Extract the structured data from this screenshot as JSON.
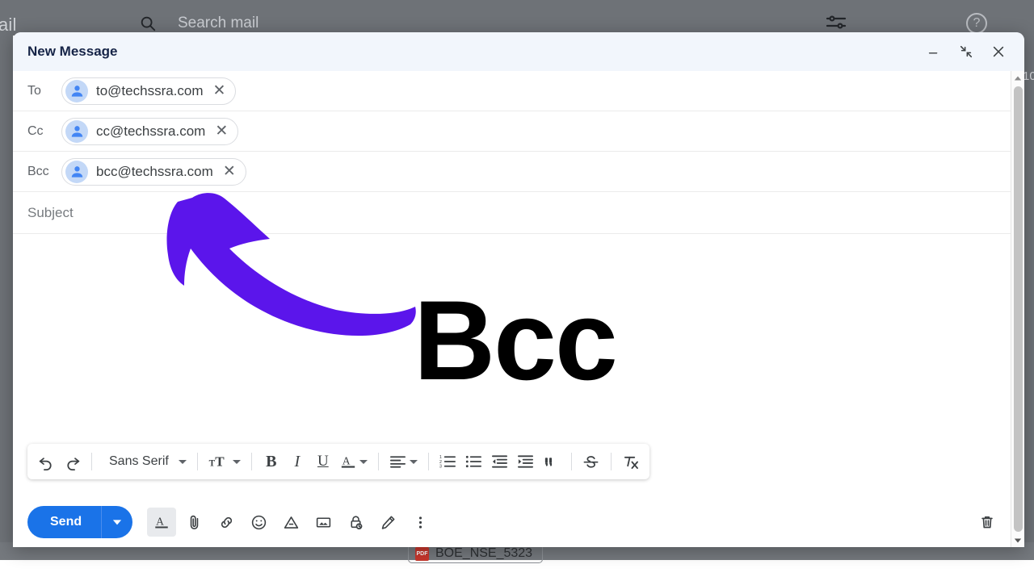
{
  "background": {
    "app_name": "ail",
    "search_placeholder": "Search mail",
    "unread_count": "10",
    "attachment": {
      "type_badge": "PDF",
      "name": "BOE_NSE_5323"
    },
    "icons": {
      "search": "search-icon",
      "tune": "tune-icon",
      "help": "help-icon"
    }
  },
  "compose": {
    "title": "New Message",
    "window_buttons": [
      {
        "name": "minimize-button",
        "glyph": "–"
      },
      {
        "name": "exit-full-screen-button",
        "glyph": "⤡"
      },
      {
        "name": "close-button",
        "glyph": "✕"
      }
    ],
    "recipients": [
      {
        "label": "To",
        "email": "to@techssra.com",
        "remove_glyph": "✕"
      },
      {
        "label": "Cc",
        "email": "cc@techssra.com",
        "remove_glyph": "✕"
      },
      {
        "label": "Bcc",
        "email": "bcc@techssra.com",
        "remove_glyph": "✕"
      }
    ],
    "subject_placeholder": "Subject",
    "body_text": "",
    "formatting_toolbar": {
      "undo": "undo-icon",
      "redo": "redo-icon",
      "font_family": "Sans Serif",
      "font_size": "font-size-icon",
      "bold": "B",
      "italic": "I",
      "underline": "U",
      "text_color": "A",
      "align": "align-icon",
      "numbered_list": "numbered-list-icon",
      "bulleted_list": "bulleted-list-icon",
      "indent_less": "indent-less-icon",
      "indent_more": "indent-more-icon",
      "quote": "”",
      "strikethrough": "strikethrough-icon",
      "remove_formatting": "remove-formatting-icon"
    },
    "action_bar": {
      "send_label": "Send",
      "send_options": "send-options-icon",
      "formatting_options": "formatting-options-icon",
      "attach_file": "attach-file-icon",
      "insert_link": "insert-link-icon",
      "insert_emoji": "insert-emoji-icon",
      "insert_drive": "insert-drive-icon",
      "insert_photo": "insert-photo-icon",
      "confidential_mode": "confidential-mode-icon",
      "insert_signature": "insert-signature-icon",
      "more_options": "more-options-icon",
      "discard_draft": "discard-draft-icon"
    }
  },
  "annotation": {
    "text": "Bcc",
    "arrow_color": "#5B15EB",
    "text_color": "#000000"
  },
  "colors": {
    "header_bg": "#F2F6FC",
    "title": "#162447",
    "send_blue": "#1A73E8",
    "chip_avatar": "#C3D8F7",
    "backdrop_gray": "#6E7277"
  }
}
